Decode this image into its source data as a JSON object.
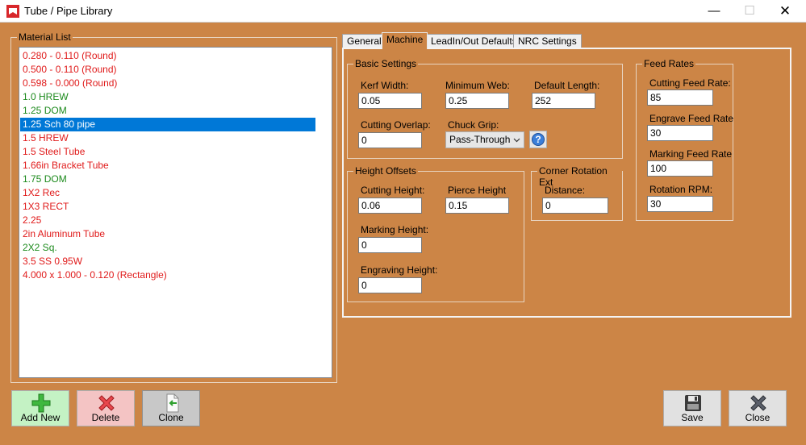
{
  "window": {
    "title": "Tube / Pipe Library",
    "minimize": "—",
    "maximize": "☐",
    "close": "✕"
  },
  "material_list": {
    "label": "Material List",
    "items": [
      {
        "text": "0.280 - 0.110 (Round)",
        "color": "red"
      },
      {
        "text": "0.500 - 0.110 (Round)",
        "color": "red"
      },
      {
        "text": "0.598 - 0.000 (Round)",
        "color": "red"
      },
      {
        "text": "1.0 HREW",
        "color": "green"
      },
      {
        "text": "1.25 DOM",
        "color": "green"
      },
      {
        "text": "1.25 Sch 80 pipe",
        "color": "selected"
      },
      {
        "text": "1.5 HREW",
        "color": "red"
      },
      {
        "text": "1.5 Steel Tube",
        "color": "red"
      },
      {
        "text": "1.66in Bracket Tube",
        "color": "red"
      },
      {
        "text": "1.75 DOM",
        "color": "green"
      },
      {
        "text": "1X2 Rec",
        "color": "red"
      },
      {
        "text": "1X3 RECT",
        "color": "red"
      },
      {
        "text": "2.25",
        "color": "red"
      },
      {
        "text": "2in Aluminum Tube",
        "color": "red"
      },
      {
        "text": "2X2 Sq.",
        "color": "green"
      },
      {
        "text": "3.5 SS 0.95W",
        "color": "red"
      },
      {
        "text": "4.000 x 1.000 - 0.120 (Rectangle)",
        "color": "red"
      }
    ]
  },
  "tabs": [
    {
      "label": "General",
      "active": false
    },
    {
      "label": "Machine",
      "active": true
    },
    {
      "label": "LeadIn/Out Defaults",
      "active": false
    },
    {
      "label": "NRC Settings",
      "active": false
    }
  ],
  "basic_settings": {
    "label": "Basic Settings",
    "kerf_width": {
      "label": "Kerf Width:",
      "value": "0.05"
    },
    "minimum_web": {
      "label": "Minimum Web:",
      "value": "0.25"
    },
    "default_length": {
      "label": "Default Length:",
      "value": "252"
    },
    "cutting_overlap": {
      "label": "Cutting Overlap:",
      "value": "0"
    },
    "chuck_grip": {
      "label": "Chuck Grip:",
      "value": "Pass-Through"
    },
    "help": "?"
  },
  "height_offsets": {
    "label": "Height Offsets",
    "cutting_height": {
      "label": "Cutting Height:",
      "value": "0.06"
    },
    "pierce_height": {
      "label": "Pierce Height",
      "value": "0.15"
    },
    "marking_height": {
      "label": "Marking Height:",
      "value": "0"
    },
    "engraving_height": {
      "label": "Engraving Height:",
      "value": "0"
    }
  },
  "corner_rotation": {
    "label": "Corner Rotation Ext",
    "distance": {
      "label": "Distance:",
      "value": "0"
    }
  },
  "feed_rates": {
    "label": "Feed Rates",
    "cutting_feed_rate": {
      "label": "Cutting Feed Rate:",
      "value": "85"
    },
    "engrave_feed_rate": {
      "label": "Engrave Feed Rate",
      "value": "30"
    },
    "marking_feed_rate": {
      "label": "Marking Feed Rate",
      "value": "100"
    },
    "rotation_rpm": {
      "label": "Rotation RPM:",
      "value": "30"
    }
  },
  "buttons": {
    "add_new": "Add New",
    "delete": "Delete",
    "clone": "Clone",
    "save": "Save",
    "close": "Close"
  },
  "colors": {
    "background": "#cc8546",
    "list_red": "#e01a1a",
    "list_green": "#1c8a1c",
    "selection": "#0078d7"
  }
}
